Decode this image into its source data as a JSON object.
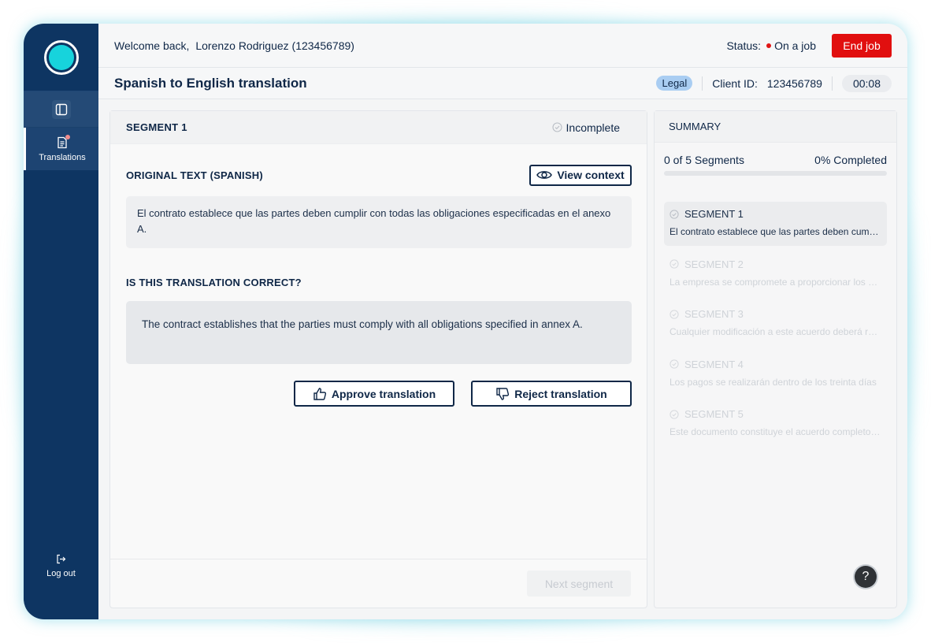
{
  "header": {
    "welcome_prefix": "Welcome back,",
    "user_name": "Lorenzo Rodriguez (123456789)",
    "status_label": "Status:",
    "status_value": "On a job",
    "end_job_label": "End job"
  },
  "sidebar": {
    "nav_items": [
      {
        "label": "Translations",
        "icon": "document-icon"
      }
    ],
    "logout_label": "Log out"
  },
  "subheader": {
    "title": "Spanish to English translation",
    "tag": "Legal",
    "client_id_label": "Client ID:",
    "client_id": "123456789",
    "timer": "00:08"
  },
  "segment": {
    "title": "SEGMENT 1",
    "status": "Incomplete",
    "original_label": "ORIGINAL TEXT (SPANISH)",
    "view_context_label": "View context",
    "original_text": "El contrato establece que las partes deben cumplir con todas las obligaciones especificadas en el anexo A.",
    "question_label": "IS THIS TRANSLATION CORRECT?",
    "translation_text": "The contract establishes that the parties must comply with all obligations specified in annex A.",
    "approve_label": "Approve translation",
    "reject_label": "Reject translation",
    "next_label": "Next segment"
  },
  "summary": {
    "title": "SUMMARY",
    "segments_count": "0 of 5 Segments",
    "completed_pct": "0% Completed",
    "progress": 0,
    "items": [
      {
        "label": "SEGMENT 1",
        "preview": "El contrato establece que las partes deben cumplir con todas las obligaciones especificadas en el anexo A."
      },
      {
        "label": "SEGMENT 2",
        "preview": "La empresa se compromete a proporcionar los servicios acordados"
      },
      {
        "label": "SEGMENT 3",
        "preview": "Cualquier modificación a este acuerdo deberá realizarse por escrito"
      },
      {
        "label": "SEGMENT 4",
        "preview": "Los pagos se realizarán dentro de los treinta días"
      },
      {
        "label": "SEGMENT 5",
        "preview": "Este documento constituye el acuerdo completo entre las partes"
      }
    ]
  },
  "help_label": "?",
  "colors": {
    "accent": "#17d3dc",
    "sidebar": "#0e3562",
    "danger": "#e10f0f",
    "tag": "#a9cdf2"
  }
}
